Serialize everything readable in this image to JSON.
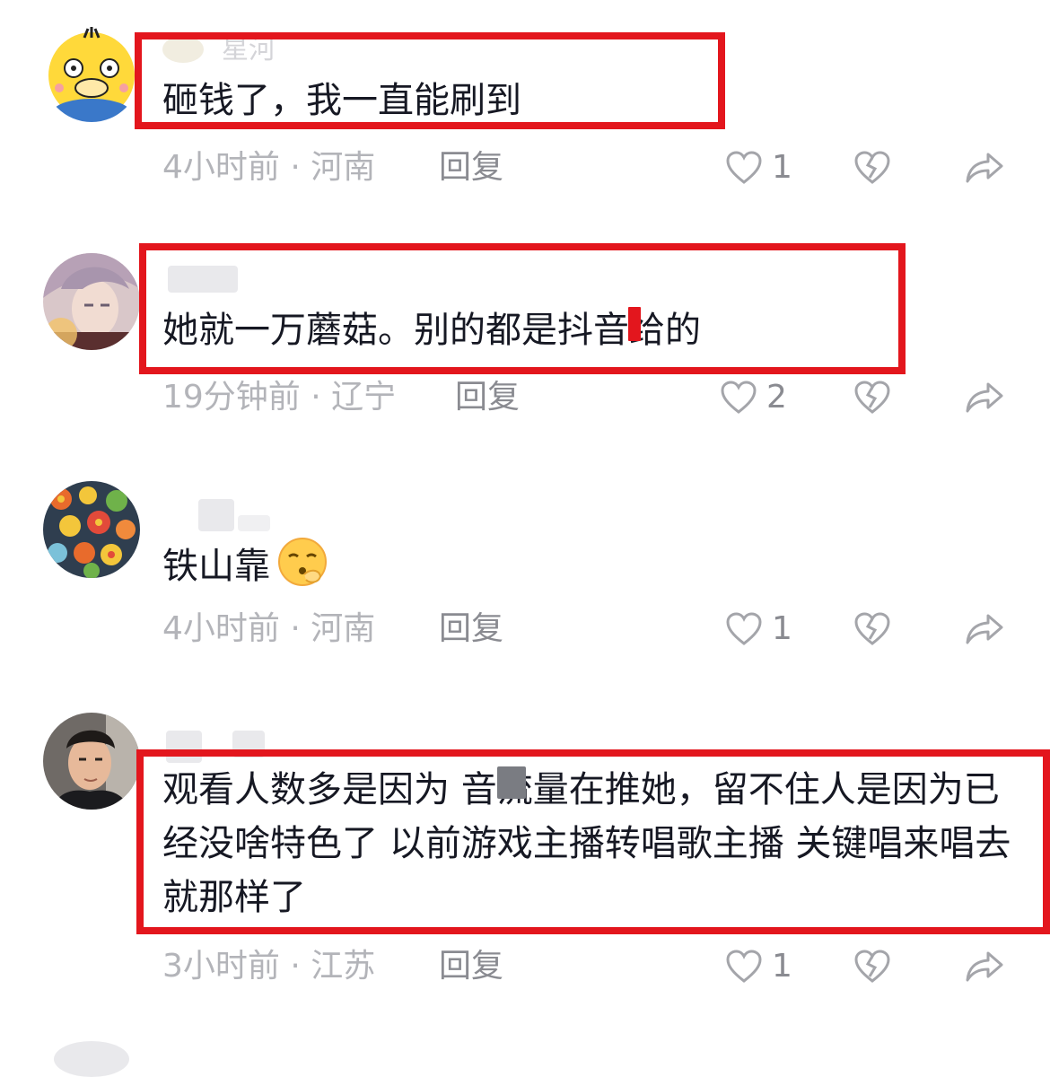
{
  "colors": {
    "highlight_border": "#e3161d",
    "comment_text": "#161823",
    "meta_text": "#b3b4b9",
    "action_text": "#8a8b91"
  },
  "comments": [
    {
      "avatar": "duck-cartoon-avatar",
      "username": "星河",
      "text": "砸钱了，我一直能刷到",
      "time_location": "4小时前 · 河南",
      "reply_label": "回复",
      "likes": "1",
      "highlighted": true
    },
    {
      "avatar": "anime-character-avatar",
      "username": "",
      "text": "她就一万蘑菇。别的都是抖音给的",
      "time_location": "19分钟前 · 辽宁",
      "reply_label": "回复",
      "likes": "2",
      "highlighted": true
    },
    {
      "avatar": "floral-pattern-avatar",
      "username": "",
      "text": "铁山靠",
      "emoji": "shushing-face-emoji",
      "time_location": "4小时前 · 河南",
      "reply_label": "回复",
      "likes": "1",
      "highlighted": false
    },
    {
      "avatar": "man-photo-avatar",
      "username": "",
      "text": "观看人数多是因为 音流量在推她，留不住人是因为已经没啥特色了 以前游戏主播转唱歌主播 关键唱来唱去就那样了",
      "time_location": "3小时前 · 江苏",
      "reply_label": "回复",
      "likes": "1",
      "highlighted": true
    }
  ],
  "icons": {
    "like": "heart-outline-icon",
    "dislike": "broken-heart-icon",
    "share": "share-arrow-icon"
  }
}
